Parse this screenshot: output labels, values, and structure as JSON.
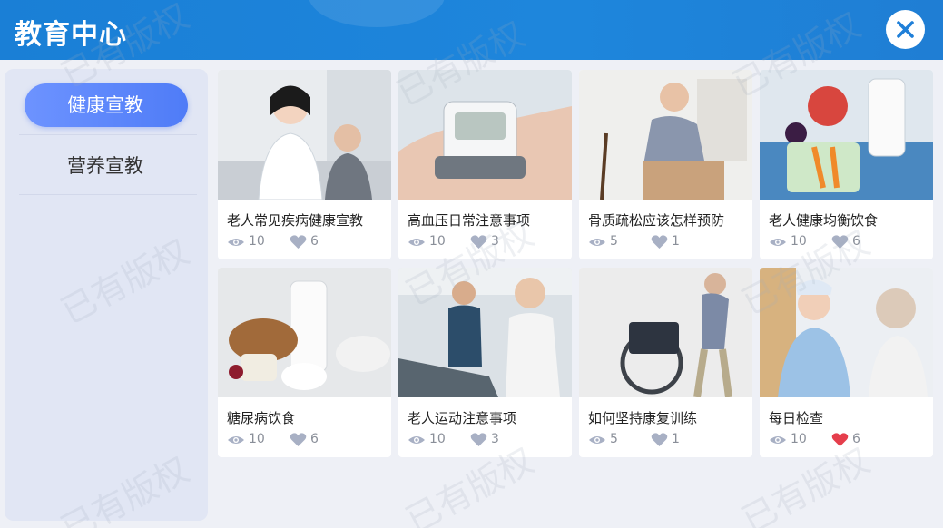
{
  "header": {
    "title": "教育中心"
  },
  "sidebar": {
    "items": [
      {
        "label": "健康宣教",
        "active": true
      },
      {
        "label": "营养宣教",
        "active": false
      }
    ]
  },
  "colors": {
    "header": "#1e86dc",
    "accent": "#5b85fb",
    "liked": "#e53e4c",
    "icon": "#a8b0c4"
  },
  "cards": [
    {
      "title": "老人常见疾病健康宣教",
      "views": "10",
      "likes": "6",
      "liked": false
    },
    {
      "title": "高血压日常注意事项",
      "views": "10",
      "likes": "3",
      "liked": false
    },
    {
      "title": "骨质疏松应该怎样预防",
      "views": "5",
      "likes": "1",
      "liked": false
    },
    {
      "title": "老人健康均衡饮食",
      "views": "10",
      "likes": "6",
      "liked": false
    },
    {
      "title": "糖尿病饮食",
      "views": "10",
      "likes": "6",
      "liked": false
    },
    {
      "title": "老人运动注意事项",
      "views": "10",
      "likes": "3",
      "liked": false
    },
    {
      "title": "如何坚持康复训练",
      "views": "5",
      "likes": "1",
      "liked": false
    },
    {
      "title": "每日检查",
      "views": "10",
      "likes": "6",
      "liked": true
    }
  ],
  "watermark": "已有版权"
}
